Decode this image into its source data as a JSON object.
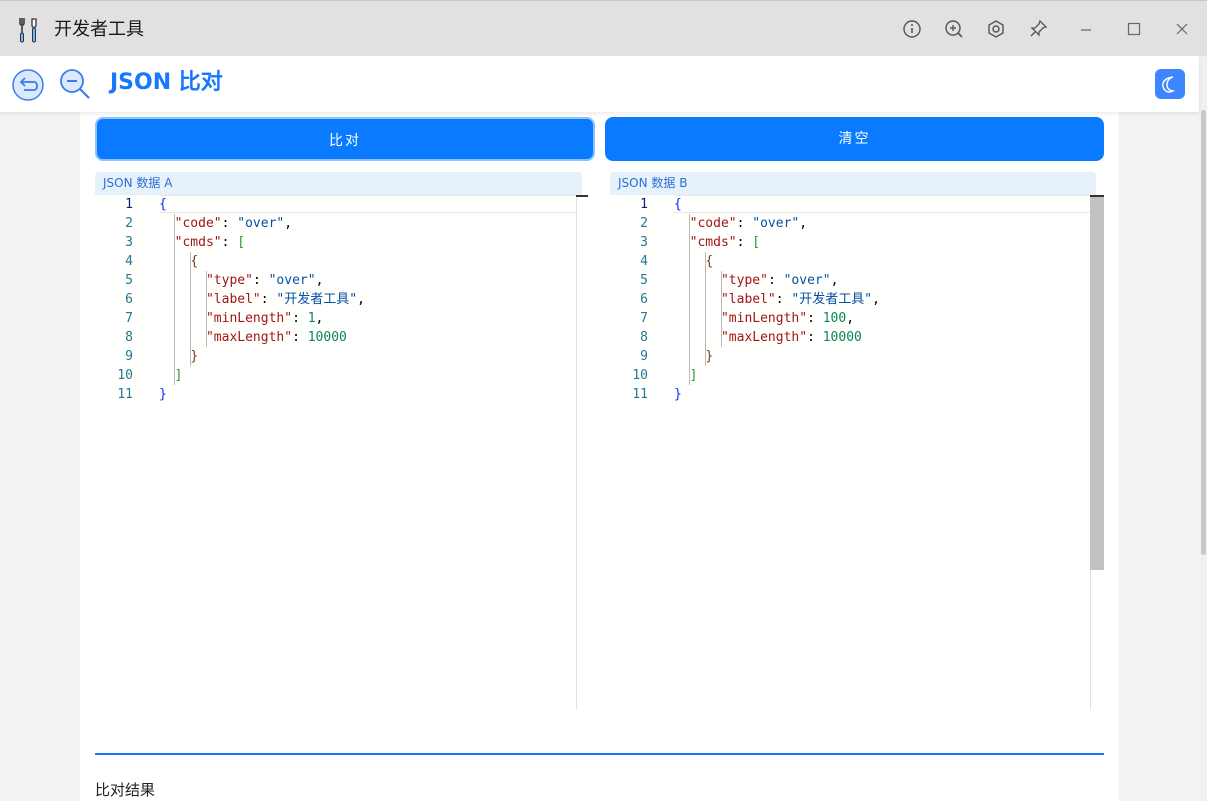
{
  "window": {
    "title": "开发者工具",
    "controls": [
      "info-icon",
      "zoom-in-icon",
      "settings-icon",
      "pin-icon",
      "minimize-icon",
      "maximize-icon",
      "close-icon"
    ]
  },
  "header": {
    "title": "JSON 比对",
    "back_icon": "back-icon",
    "search_icon": "zoom-out-icon",
    "theme_icon": "moon-icon"
  },
  "toolbar": {
    "compare_label": "比对",
    "clear_label": "清空"
  },
  "editor_a": {
    "label": "JSON 数据 A",
    "line_numbers": [
      "1",
      "2",
      "3",
      "4",
      "5",
      "6",
      "7",
      "8",
      "9",
      "10",
      "11"
    ]
  },
  "editor_b": {
    "label": "JSON 数据 B",
    "line_numbers": [
      "1",
      "2",
      "3",
      "4",
      "5",
      "6",
      "7",
      "8",
      "9",
      "10",
      "11"
    ]
  },
  "json_a": {
    "code": "over",
    "type": "over",
    "label": "开发者工具",
    "minLength": "1",
    "maxLength": "10000"
  },
  "json_b": {
    "code": "over",
    "type": "over",
    "label": "开发者工具",
    "minLength": "100",
    "maxLength": "10000"
  },
  "result": {
    "label": "比对结果"
  },
  "colors": {
    "accent": "#1677ff",
    "button": "#0a7bff",
    "json_key": "#a31515",
    "json_string": "#0451a5",
    "json_number": "#098658"
  }
}
